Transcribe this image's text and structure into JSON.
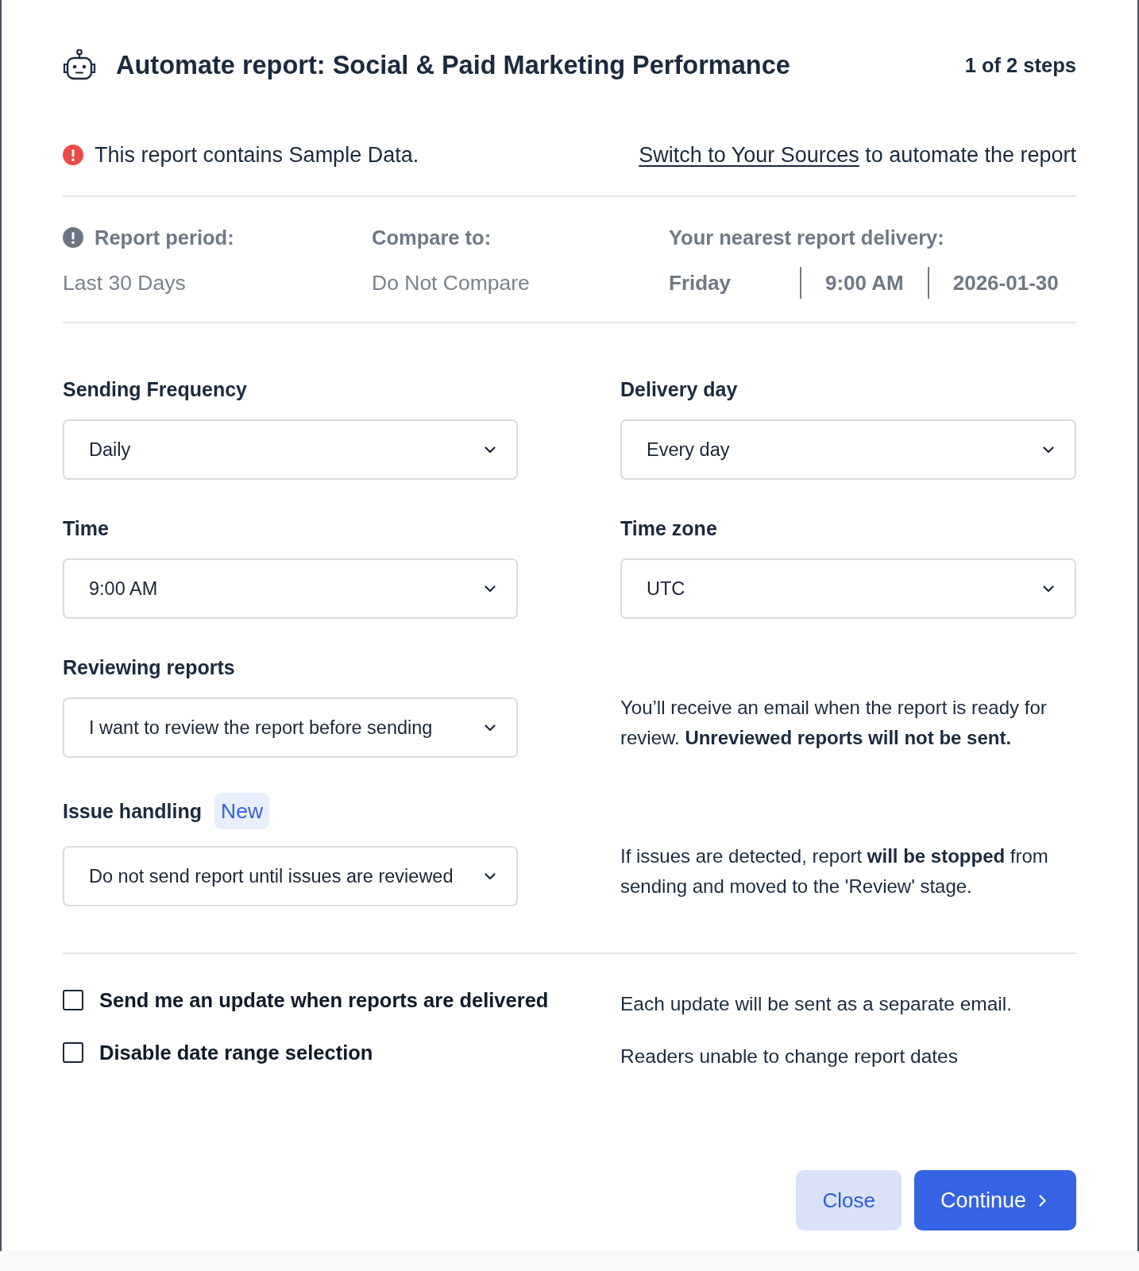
{
  "dialog": {
    "title": "Automate report: Social & Paid Marketing Performance",
    "step_indicator": "1 of 2 steps"
  },
  "notice": {
    "message": "This report contains Sample Data.",
    "link": "Switch to Your Sources",
    "link_suffix": "to automate the report"
  },
  "summary": [
    {
      "label": "Report period:",
      "value": "Last 30 Days"
    },
    {
      "label": "Compare to:",
      "value": "Do Not Compare"
    },
    {
      "label": "Your nearest report delivery:",
      "values": [
        "Friday",
        "9:00 AM",
        "2026-01-30"
      ]
    }
  ],
  "settings": [
    {
      "label": "Sending Frequency",
      "value": "Daily"
    },
    {
      "label": "Delivery day",
      "value": "Every day"
    },
    {
      "label": "Time",
      "value": "9:00 AM"
    },
    {
      "label": "Time zone",
      "value": "UTC"
    },
    {
      "label": "Reviewing reports",
      "value": "I want to review the report before sending",
      "note": "You’ll receive an email when the report is ready for review. **Unreviewed reports will not be sent.**"
    },
    {
      "label": "Issue handling",
      "badge": "New",
      "value": "Do not send report until issues are reviewed",
      "note": "If issues are detected, report **will be stopped** from sending and moved to the 'Review' stage."
    }
  ],
  "options": [
    {
      "label": "Send me an update when reports are delivered",
      "checked": false,
      "hint": "Each update will be sent as a separate email."
    },
    {
      "label": "Disable date range selection",
      "checked": false,
      "hint": "Readers unable to change report dates"
    }
  ],
  "buttons": [
    {
      "label": "Close",
      "kind": "secondary"
    },
    {
      "label": "Continue",
      "kind": "primary"
    }
  ]
}
